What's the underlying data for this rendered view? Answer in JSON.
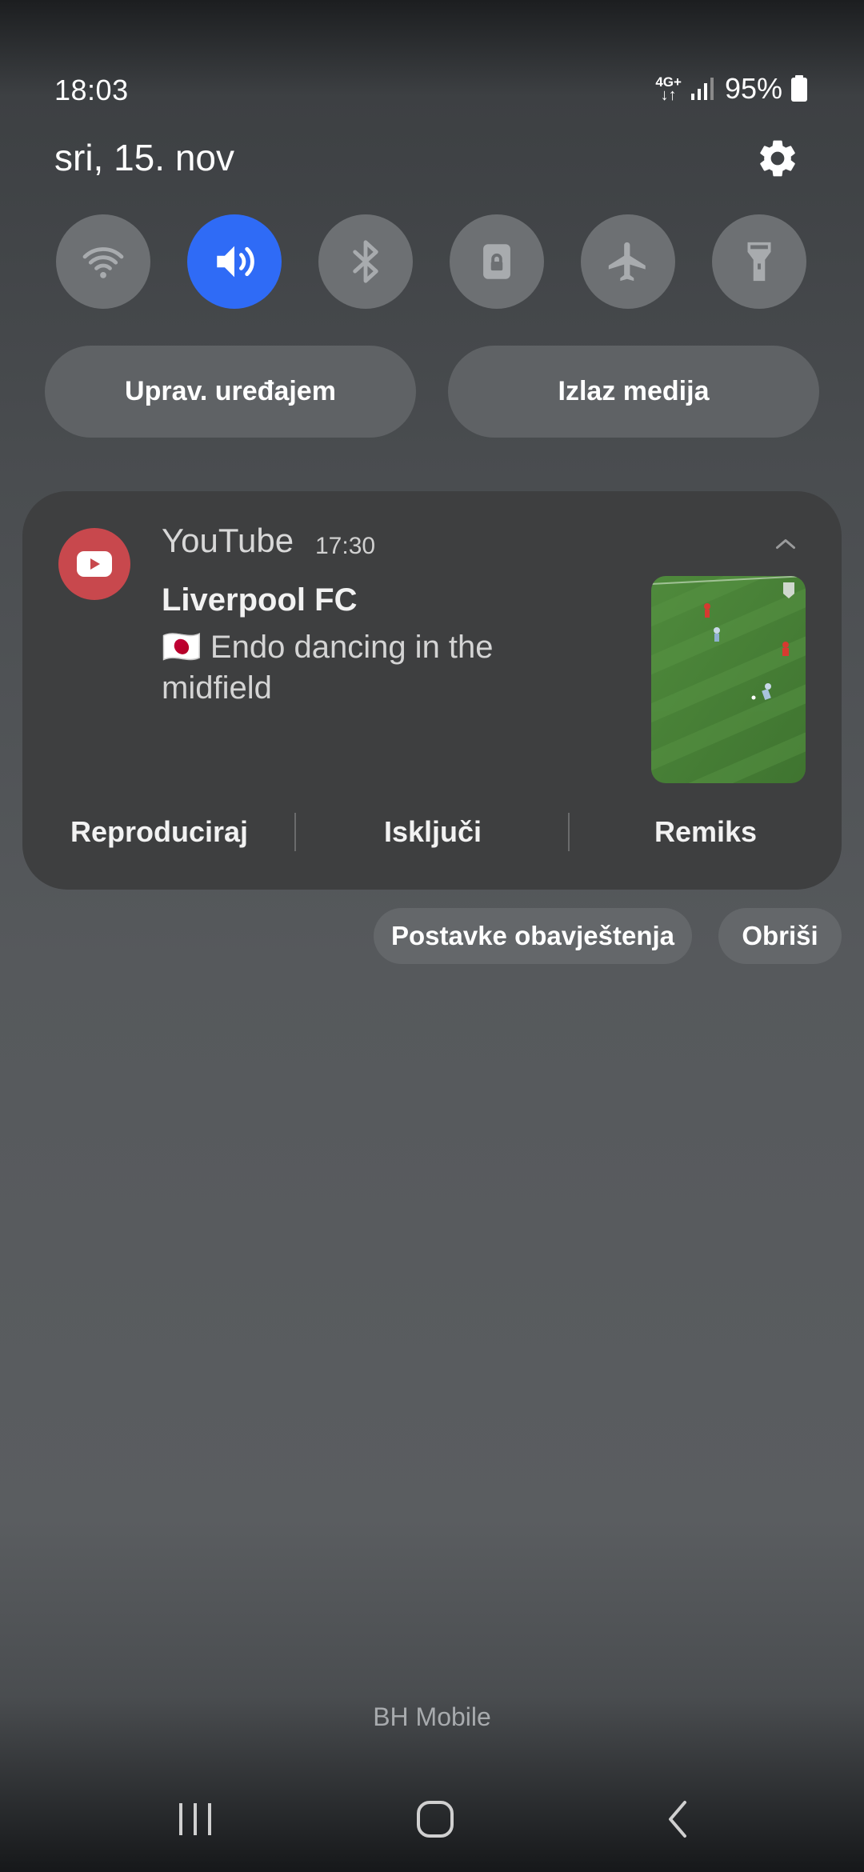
{
  "status_bar": {
    "time": "18:03",
    "network_type": "4G+",
    "battery_percent": "95%",
    "icons": [
      "network-4g-icon",
      "signal-icon",
      "battery-icon"
    ]
  },
  "header": {
    "date": "sri, 15. nov",
    "settings_icon": "gear-icon"
  },
  "quick_settings": [
    {
      "name": "wifi",
      "icon": "wifi-icon",
      "active": false
    },
    {
      "name": "sound",
      "icon": "sound-icon",
      "active": true
    },
    {
      "name": "bluetooth",
      "icon": "bluetooth-icon",
      "active": false
    },
    {
      "name": "rotation-lock",
      "icon": "lock-icon",
      "active": false
    },
    {
      "name": "airplane-mode",
      "icon": "airplane-icon",
      "active": false
    },
    {
      "name": "flashlight",
      "icon": "flashlight-icon",
      "active": false
    }
  ],
  "pills": {
    "device_control": "Uprav. uređajem",
    "media_output": "Izlaz medija"
  },
  "notification": {
    "app_name": "YouTube",
    "time": "17:30",
    "title": "Liverpool FC",
    "text": "🇯🇵 Endo dancing in the midfield",
    "actions": [
      "Reproduciraj",
      "Isključi",
      "Remiks"
    ]
  },
  "notification_controls": {
    "settings": "Postavke obavještenja",
    "clear": "Obriši"
  },
  "carrier": "BH Mobile",
  "colors": {
    "accent": "#2f6bf6",
    "youtube_red": "#c8484d",
    "card_bg": "#3e3f40"
  }
}
